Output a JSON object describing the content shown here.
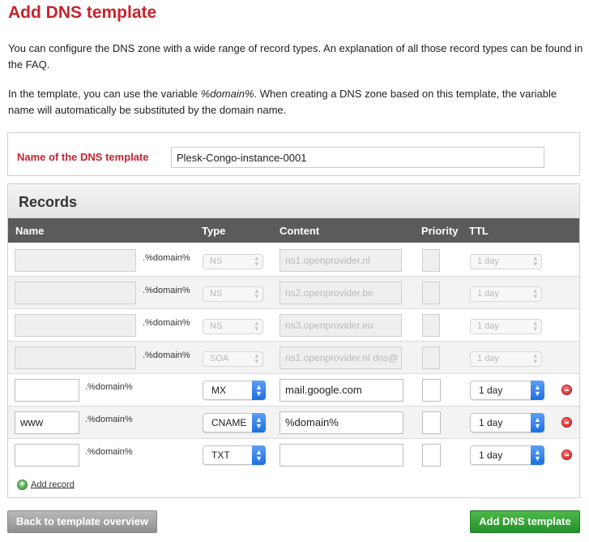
{
  "page": {
    "title": "Add DNS template",
    "intro1": "You can configure the DNS zone with a wide range of record types. An explanation of all those record types can be found in the FAQ.",
    "intro2_before": "In the template, you can use the variable ",
    "intro2_var": "%domain%",
    "intro2_after": ". When creating a DNS zone based on this template, the variable name will automatically be substituted by the domain name."
  },
  "template_name": {
    "label": "Name of the DNS template",
    "value": "Plesk-Congo-instance-0001"
  },
  "records": {
    "title": "Records",
    "columns": {
      "name": "Name",
      "type": "Type",
      "content": "Content",
      "priority": "Priority",
      "ttl": "TTL"
    },
    "suffix": ".%domain%",
    "rows": [
      {
        "name": "",
        "type": "NS",
        "content": "ns1.openprovider.nl",
        "priority": "",
        "ttl": "1 day",
        "locked": true
      },
      {
        "name": "",
        "type": "NS",
        "content": "ns2.openprovider.be",
        "priority": "",
        "ttl": "1 day",
        "locked": true
      },
      {
        "name": "",
        "type": "NS",
        "content": "ns3.openprovider.eu",
        "priority": "",
        "ttl": "1 day",
        "locked": true
      },
      {
        "name": "",
        "type": "SOA",
        "content": "ns1.openprovider.nl dns@",
        "priority": "",
        "ttl": "1 day",
        "locked": true
      },
      {
        "name": "",
        "type": "MX",
        "content": "mail.google.com",
        "priority": "",
        "ttl": "1 day",
        "locked": false
      },
      {
        "name": "www",
        "type": "CNAME",
        "content": "%domain%",
        "priority": "",
        "ttl": "1 day",
        "locked": false
      },
      {
        "name": "",
        "type": "TXT",
        "content": "",
        "priority": "",
        "ttl": "1 day",
        "locked": false
      }
    ],
    "add_record": "Add record"
  },
  "buttons": {
    "back": "Back to template overview",
    "add": "Add DNS template"
  }
}
